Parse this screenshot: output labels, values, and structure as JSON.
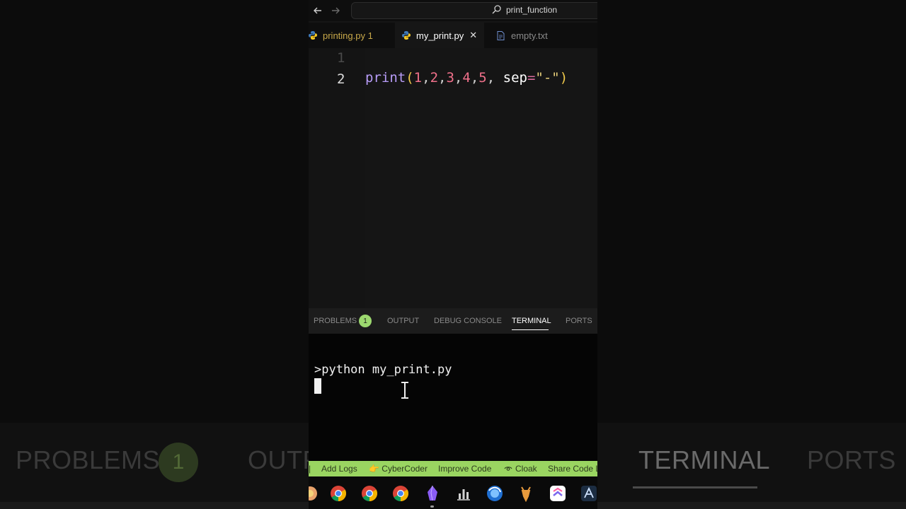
{
  "backdrop": {
    "problems": "PROBLEMS",
    "problems_badge": "1",
    "output": "OUTP",
    "terminal": "TERMINAL",
    "ports": "PORTS"
  },
  "titlebar": {
    "search_text": "print_function",
    "back_icon": "arrow-left-icon",
    "forward_icon": "arrow-right-icon"
  },
  "tabs": [
    {
      "label": "printing.py 1",
      "icon": "python-icon",
      "color": "#c9a94a"
    },
    {
      "label": "my_print.py",
      "icon": "python-icon",
      "color": "#ffffff",
      "active": true,
      "close": "✕"
    },
    {
      "label": "empty.txt",
      "icon": "file-icon",
      "color": "#8a8a8a"
    }
  ],
  "editor": {
    "line_numbers": [
      "1",
      "2"
    ],
    "code_line_2": {
      "func": "print",
      "open": "(",
      "args": [
        "1",
        "2",
        "3",
        "4",
        "5"
      ],
      "kw": "sep",
      "eq": "=",
      "str": "\"-\"",
      "close": ")"
    }
  },
  "panel": {
    "tabs": [
      "PROBLEMS",
      "OUTPUT",
      "DEBUG CONSOLE",
      "TERMINAL",
      "PORTS"
    ],
    "problems_badge": "1",
    "active_tab": "TERMINAL"
  },
  "terminal": {
    "command": ">python my_print.py"
  },
  "statusbar": {
    "items": [
      "Add Logs",
      "👉 CyberCoder",
      "Improve Code",
      "Cloak",
      "Share Code L"
    ],
    "cloak_icon": "eye-icon"
  },
  "taskbar": {
    "icons": [
      "app-icon",
      "chrome-icon",
      "chrome-icon",
      "chrome-icon",
      "obsidian-icon",
      "chart-app-icon",
      "browser-icon",
      "deer-app-icon",
      "clickup-icon",
      "pen-app-icon"
    ]
  },
  "colors": {
    "accent_green": "#9ad561",
    "keyword_purple": "#b79cf7",
    "number_red": "#f0708a",
    "string_yellow": "#e8d07a"
  }
}
